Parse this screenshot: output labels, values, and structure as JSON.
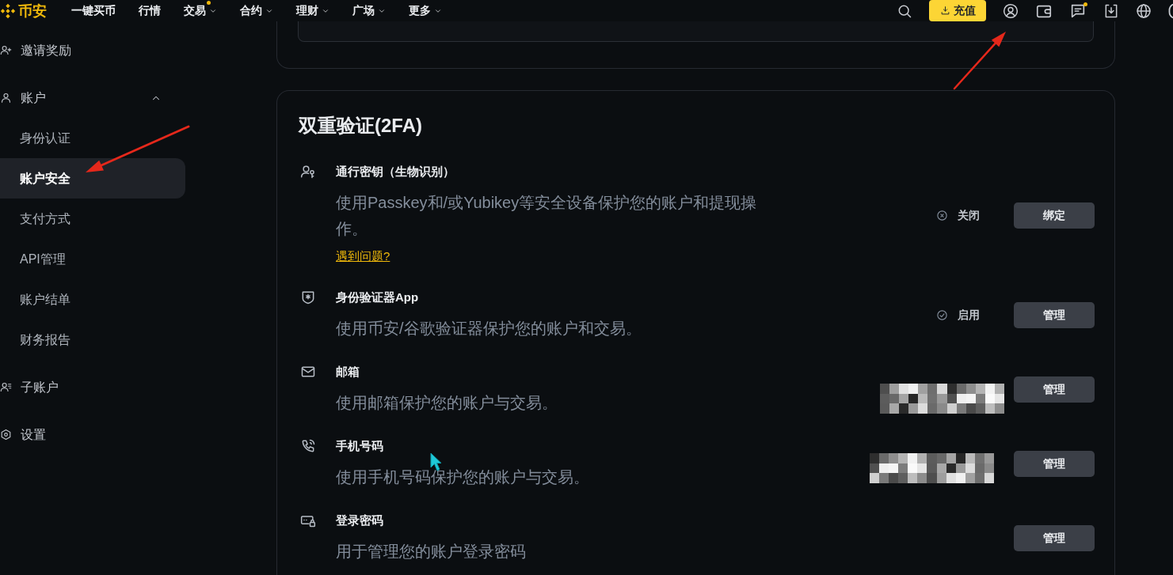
{
  "header": {
    "logo": "币安",
    "nav": [
      {
        "label": "一键买币",
        "dropdown": false,
        "dot": false
      },
      {
        "label": "行情",
        "dropdown": false,
        "dot": false
      },
      {
        "label": "交易",
        "dropdown": true,
        "dot": true
      },
      {
        "label": "合约",
        "dropdown": true,
        "dot": false
      },
      {
        "label": "理财",
        "dropdown": true,
        "dot": false
      },
      {
        "label": "广场",
        "dropdown": true,
        "dot": false
      },
      {
        "label": "更多",
        "dropdown": true,
        "dot": false
      }
    ],
    "actions": [
      {
        "kind": "search",
        "dot": false
      },
      {
        "kind": "deposit",
        "label": "充值",
        "dot": false
      },
      {
        "kind": "user",
        "dot": false
      },
      {
        "kind": "wallet",
        "dot": false
      },
      {
        "kind": "messages",
        "dot": true
      },
      {
        "kind": "download",
        "dot": false
      },
      {
        "kind": "globe",
        "dot": false
      }
    ]
  },
  "sidebar": {
    "items": [
      {
        "kind": "invite",
        "label": "邀请奖励",
        "selected": false
      },
      {
        "kind": "account",
        "label": "账户",
        "selected": false,
        "expanded": true,
        "children": [
          {
            "label": "身份认证",
            "selected": false
          },
          {
            "label": "账户安全",
            "selected": true
          },
          {
            "label": "支付方式",
            "selected": false
          },
          {
            "label": "API管理",
            "selected": false
          },
          {
            "label": "账户结单",
            "selected": false
          },
          {
            "label": "财务报告",
            "selected": false
          }
        ]
      },
      {
        "kind": "subaccount",
        "label": "子账户",
        "selected": false
      },
      {
        "kind": "settings",
        "label": "设置",
        "selected": false
      }
    ]
  },
  "security": {
    "title": "双重验证(2FA)",
    "rows": [
      {
        "kind": "passkey",
        "title": "通行密钥（生物识别）",
        "description": "使用Passkey和/或Yubikey等安全设备保护您的账户和提现操作。",
        "link": "遇到问题?",
        "status": {
          "label": "关闭",
          "enabled": false
        },
        "masked": false,
        "button": "绑定"
      },
      {
        "kind": "authenticator",
        "title": "身份验证器App",
        "description": "使用币安/谷歌验证器保护您的账户和交易。",
        "status": {
          "label": "启用",
          "enabled": true
        },
        "masked": false,
        "button": "管理"
      },
      {
        "kind": "email",
        "title": "邮箱",
        "description": "使用邮箱保护您的账户与交易。",
        "masked": true,
        "button": "管理"
      },
      {
        "kind": "phone",
        "title": "手机号码",
        "description": "使用手机号码保护您的账户与交易。",
        "masked": true,
        "button": "管理"
      },
      {
        "kind": "password",
        "title": "登录密码",
        "description": "用于管理您的账户登录密码",
        "masked": false,
        "button": "管理"
      }
    ]
  }
}
